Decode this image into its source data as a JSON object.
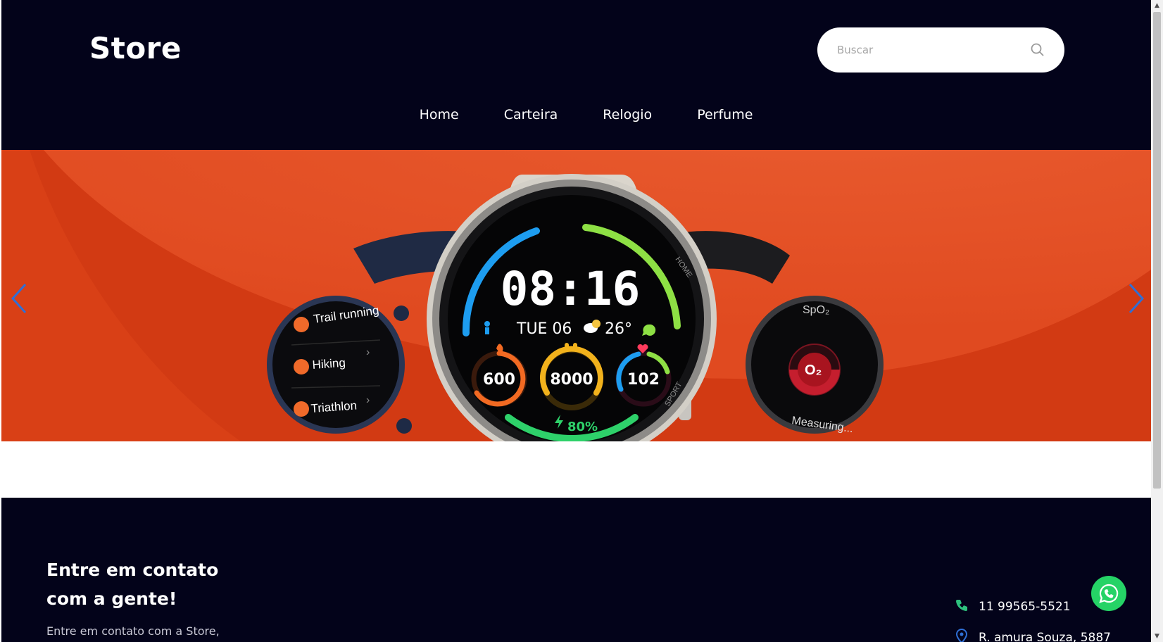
{
  "header": {
    "brand": "Store",
    "search": {
      "placeholder": "Buscar",
      "icon": "search-icon"
    },
    "nav": [
      {
        "label": "Home"
      },
      {
        "label": "Carteira"
      },
      {
        "label": "Relogio"
      },
      {
        "label": "Perfume"
      }
    ]
  },
  "carousel": {
    "prev_icon": "chevron-left-icon",
    "next_icon": "chevron-right-icon",
    "slide": {
      "background_color": "#d23a13",
      "left_watch": {
        "items": [
          "Trail running",
          "Hiking",
          "Triathlon"
        ]
      },
      "center_watch": {
        "time": "08:16",
        "date": "TUE 06",
        "temperature": "26°",
        "calories": "600",
        "steps": "8000",
        "heart_rate": "102",
        "battery": "80%",
        "bezel_top": "HOME",
        "bezel_bottom": "SPORT"
      },
      "right_watch": {
        "title": "SpO₂",
        "badge": "O₂",
        "status": "Measuring..."
      }
    }
  },
  "footer": {
    "contact_title": "Entre em contato com a gente!",
    "contact_text": "Entre em contato com a Store,",
    "phone": "11 99565-5521",
    "address": "R. amura Souza, 5887",
    "whatsapp_icon": "whatsapp-icon"
  },
  "colors": {
    "dark_navy": "#03031a",
    "banner_orange": "#d23a13",
    "accent_blue": "#2f6fd6",
    "whatsapp_green": "#25d366"
  }
}
